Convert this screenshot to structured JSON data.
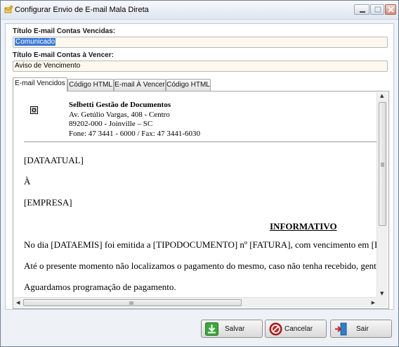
{
  "window": {
    "title": "Configurar Envio de E-mail Mala Direta"
  },
  "fields": {
    "overdue_label": "Título E-mail Contas Vencidas:",
    "overdue_value": "Comunicado",
    "upcoming_label": "Título E-mail Contas à Vencer:",
    "upcoming_value": "Aviso de Vencimento"
  },
  "tabs": [
    {
      "label": "E-mail Vencidos",
      "active": true
    },
    {
      "label": "Código HTML",
      "active": false
    },
    {
      "label": "E-mail À Vencer",
      "active": false
    },
    {
      "label": "Código HTML",
      "active": false
    }
  ],
  "document": {
    "company_name": "Selbetti Gestão de Documentos",
    "address_line1": "Av. Getúlio Vargas, 408 - Centro",
    "address_line2": "89202-000 - Joinville – SC",
    "phone_line": "Fone: 47 3441 - 6000 / Fax: 47 3441-6030",
    "date_placeholder": "[DATAATUAL]",
    "to_line": "À",
    "company_placeholder": "[EMPRESA]",
    "heading": "INFORMATIVO",
    "paragraph1": "No dia [DATAEMIS] foi emitida a [TIPODOCUMENTO] nº [FATURA], com vencimento em [DATAVENC]",
    "paragraph2": "Até o presente momento não localizamos o pagamento do mesmo, caso não tenha recebido, gentileza entrar em contato",
    "paragraph3": "Aguardamos programação de pagamento."
  },
  "buttons": {
    "save": "Salvar",
    "cancel": "Cancelar",
    "exit": "Sair"
  },
  "colors": {
    "selection": "#3a78d4",
    "input_bg": "#fdf8ee",
    "save_icon": "#3aa73a",
    "cancel_icon": "#c8201e",
    "exit_icon": "#2a7fd0"
  },
  "icons": {
    "app": "mail-app-icon",
    "logo": "broken-image-icon",
    "save": "save-download-icon",
    "cancel": "cancel-icon",
    "exit": "exit-door-icon"
  }
}
